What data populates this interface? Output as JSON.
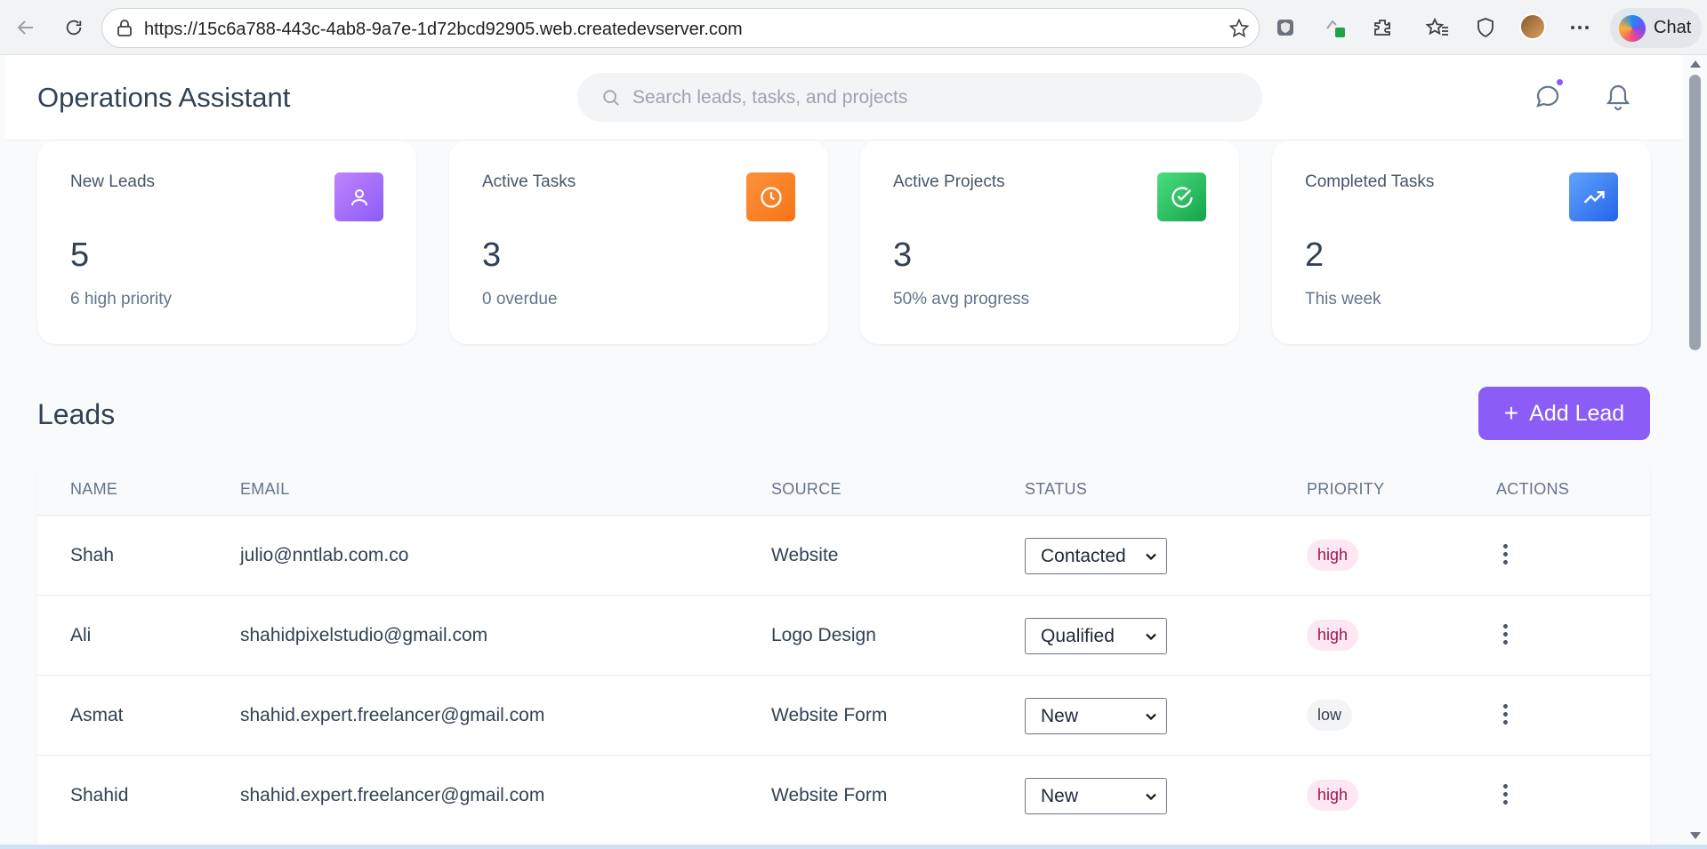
{
  "browser": {
    "url": "https://15c6a788-443c-4ab8-9a7e-1d72bcd92905.web.createdevserver.com",
    "copilot_label": "Chat"
  },
  "app": {
    "title": "Operations Assistant",
    "search_placeholder": "Search leads, tasks, and projects"
  },
  "stats": [
    {
      "label": "New Leads",
      "value": "5",
      "sub": "6 high priority",
      "icon": "user-icon",
      "color": "#a78bfa"
    },
    {
      "label": "Active Tasks",
      "value": "3",
      "sub": "0 overdue",
      "icon": "clock-icon",
      "color": "#f97316"
    },
    {
      "label": "Active Projects",
      "value": "3",
      "sub": "50% avg progress",
      "icon": "check-circle-icon",
      "color": "#22c55e"
    },
    {
      "label": "Completed Tasks",
      "value": "2",
      "sub": "This week",
      "icon": "trending-up-icon",
      "color": "#3b82f6"
    }
  ],
  "leads": {
    "title": "Leads",
    "add_label": "Add Lead",
    "columns": [
      "NAME",
      "EMAIL",
      "SOURCE",
      "STATUS",
      "PRIORITY",
      "ACTIONS"
    ],
    "rows": [
      {
        "name": "Shah",
        "email": "julio@nntlab.com.co",
        "source": "Website",
        "status": "Contacted",
        "priority": "high"
      },
      {
        "name": "Ali",
        "email": "shahidpixelstudio@gmail.com",
        "source": "Logo Design",
        "status": "Qualified",
        "priority": "high"
      },
      {
        "name": "Asmat",
        "email": "shahid.expert.freelancer@gmail.com",
        "source": "Website Form",
        "status": "New",
        "priority": "low"
      },
      {
        "name": "Shahid",
        "email": "shahid.expert.freelancer@gmail.com",
        "source": "Website Form",
        "status": "New",
        "priority": "high"
      }
    ]
  },
  "colors": {
    "accent": "#8b5cf6",
    "high_bg": "#fce7f3",
    "high_text": "#9d174d",
    "low_bg": "#f3f4f6"
  }
}
